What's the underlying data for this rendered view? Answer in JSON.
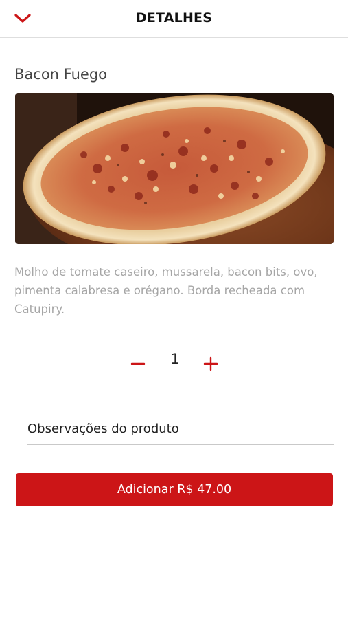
{
  "colors": {
    "accent": "#cc1517",
    "description_text": "#a6a6a6",
    "divider": "#dedede"
  },
  "header": {
    "title": "DETALHES",
    "back_icon": "chevron-down-icon"
  },
  "product": {
    "name": "Bacon Fuego",
    "image_icon": "pizza-photo",
    "description": "Molho de tomate caseiro, mussarela, bacon bits, ovo, pimenta calabresa e orégano. Borda recheada com Catupiry."
  },
  "quantity": {
    "value": "1",
    "decrement_icon": "minus-icon",
    "increment_icon": "plus-icon"
  },
  "notes": {
    "placeholder": "Observações do produto",
    "value": ""
  },
  "add_button": {
    "label": "Adicionar R$ 47.00"
  }
}
